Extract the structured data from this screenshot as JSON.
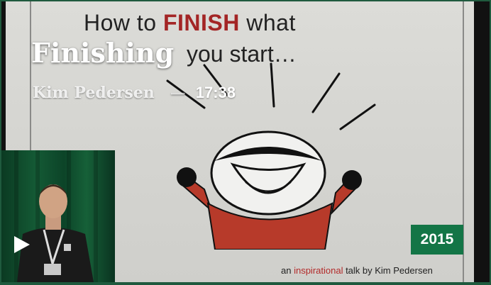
{
  "talk": {
    "title": "Finishing",
    "speaker": "Kim Pedersen",
    "separator": "—",
    "duration": "17:38",
    "year": "2015"
  },
  "slide": {
    "headline_pre": "How to ",
    "headline_emphasis": "FINISH",
    "headline_post": " what",
    "headline_line2": "you start…",
    "footer_pre": "an ",
    "footer_emphasis": "inspirational",
    "footer_post": " talk by Kim Pedersen"
  },
  "icons": {
    "play": "play-icon"
  },
  "colors": {
    "badge": "#137546",
    "border": "#1f5a3e",
    "slide_accent": "#a32525"
  }
}
